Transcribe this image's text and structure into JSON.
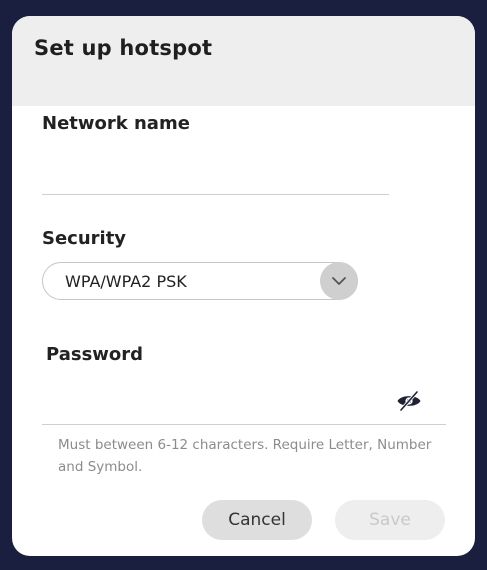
{
  "dialog": {
    "title": "Set up hotspot"
  },
  "network_name": {
    "label": "Network name",
    "value": ""
  },
  "security": {
    "label": "Security",
    "selected": "WPA/WPA2 PSK",
    "chevron_icon": "chevron-down-icon"
  },
  "password": {
    "label": "Password",
    "value": "",
    "visibility_icon": "eye-slash-icon",
    "hint": "Must between 6-12 characters. Require Letter, Number and Symbol."
  },
  "buttons": {
    "cancel_label": "Cancel",
    "save_label": "Save"
  },
  "colors": {
    "backdrop": "#1b1f3f",
    "header_bg": "#eeeeee",
    "cancel_bg": "#dedede",
    "save_bg_disabled": "#eeeeee"
  }
}
